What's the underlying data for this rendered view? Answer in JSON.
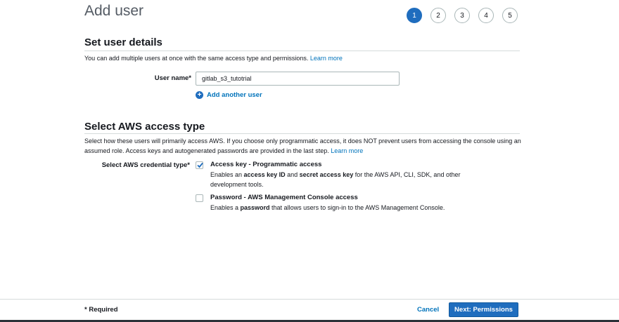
{
  "header": {
    "title": "Add user"
  },
  "steps": [
    {
      "label": "1",
      "active": true
    },
    {
      "label": "2",
      "active": false
    },
    {
      "label": "3",
      "active": false
    },
    {
      "label": "4",
      "active": false
    },
    {
      "label": "5",
      "active": false
    }
  ],
  "set_user_details": {
    "title": "Set user details",
    "description": "You can add multiple users at once with the same access type and permissions.",
    "learn_more": "Learn more",
    "user_name_label": "User name*",
    "user_name_value": "gitlab_s3_tutotrial",
    "add_another_user": "Add another user"
  },
  "access_type": {
    "title": "Select AWS access type",
    "description": "Select how these users will primarily access AWS. If you choose only programmatic access, it does NOT prevent users from accessing the console using an assumed role. Access keys and autogenerated passwords are provided in the last step.",
    "learn_more": "Learn more",
    "credential_label": "Select AWS credential type*",
    "options": [
      {
        "title": "Access key - Programmatic access",
        "desc_pre": "Enables an ",
        "desc_b1": "access key ID",
        "desc_mid": " and ",
        "desc_b2": "secret access key",
        "desc_post": " for the AWS API, CLI, SDK, and other development tools.",
        "checked": true
      },
      {
        "title": "Password - AWS Management Console access",
        "desc_pre": "Enables a ",
        "desc_b1": "password",
        "desc_post": " that allows users to sign-in to the AWS Management Console.",
        "checked": false
      }
    ]
  },
  "footer": {
    "required_note": "* Required",
    "cancel_label": "Cancel",
    "next_label": "Next: Permissions"
  },
  "colors": {
    "accent": "#1f6dbe",
    "link": "#0073bb",
    "border": "#d5dbdb"
  }
}
